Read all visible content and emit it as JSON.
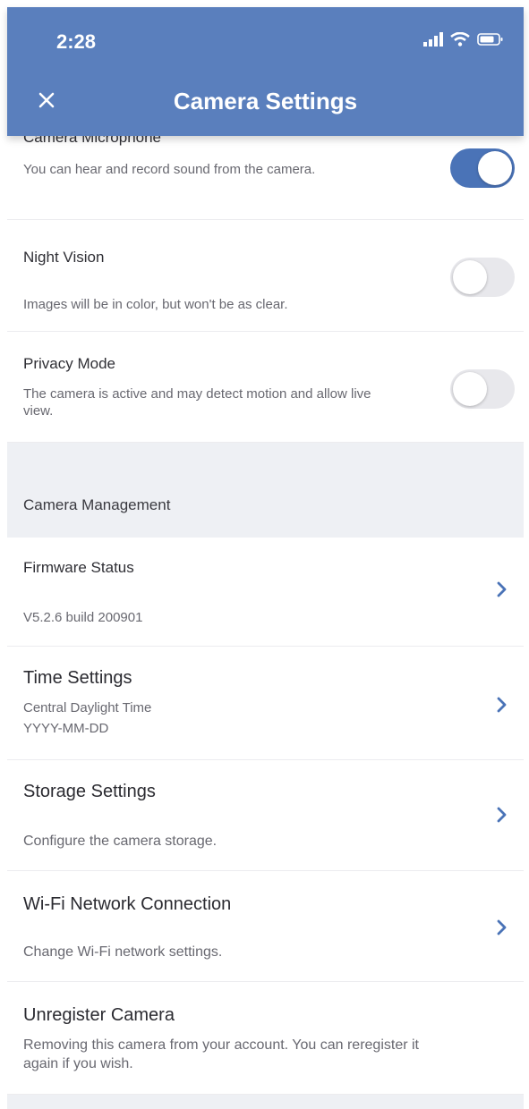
{
  "status_bar": {
    "time": "2:28",
    "signal_icon": "cellular-signal-icon",
    "wifi_icon": "wifi-icon",
    "battery_icon": "battery-icon"
  },
  "header": {
    "title": "Camera Settings",
    "close_icon": "close-icon",
    "background": "#5a7fbd"
  },
  "toggles": [
    {
      "title": "Camera Microphone",
      "description": "You can hear and record sound from the camera.",
      "on": true
    },
    {
      "title": "Night Vision",
      "description": "Images will be in color, but won't be as clear.",
      "on": false
    },
    {
      "title": "Privacy Mode",
      "description": "The camera is active and may detect motion and allow live view.",
      "on": false
    }
  ],
  "section": {
    "label": "Camera Management"
  },
  "management": [
    {
      "title": "Firmware Status",
      "description": "V5.2.6 build 200901"
    },
    {
      "title": "Time Settings",
      "description_line1": "Central Daylight Time",
      "description_line2": "YYYY-MM-DD"
    },
    {
      "title": "Storage Settings",
      "description": "Configure the camera storage."
    },
    {
      "title": "Wi-Fi Network Connection",
      "description": "Change Wi-Fi network settings."
    },
    {
      "title": "Unregister Camera",
      "description": "Removing this camera from your account. You can reregister it again if you wish."
    }
  ],
  "colors": {
    "accent": "#4a73b7",
    "toggle_off": "#e8e8ec",
    "chevron": "#4a73b7",
    "section_band": "#eef0f4"
  }
}
